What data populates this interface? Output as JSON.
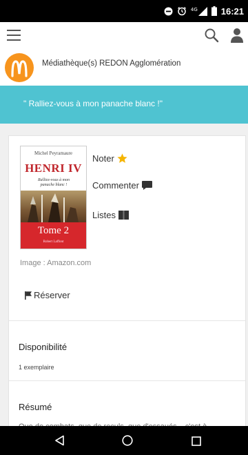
{
  "status_bar": {
    "time": "16:21",
    "network": "4G",
    "icons": [
      "do-not-disturb-icon",
      "alarm-icon",
      "signal-icon",
      "battery-icon"
    ]
  },
  "app_bar": {
    "icons": [
      "hamburger-menu-icon",
      "search-icon",
      "user-icon"
    ]
  },
  "library": {
    "name": "Médiathèque(s) REDON Agglomération",
    "logo_color": "#f7941d"
  },
  "banner": {
    "text": "\" Ralliez-vous à mon panache blanc !\"",
    "color": "#4fc3d1"
  },
  "book": {
    "cover": {
      "author": "Michel Peyramaure",
      "title": "HENRI IV",
      "subtitle": "Ralliez-vous à mon panache blanc !",
      "tome": "Tome 2",
      "publisher": "Robert Laffont"
    },
    "image_credit": "Image : Amazon.com",
    "actions": [
      {
        "label": "Noter",
        "icon": "star-icon"
      },
      {
        "label": "Commenter",
        "icon": "comment-icon"
      },
      {
        "label": "Listes",
        "icon": "book-icon"
      }
    ],
    "reserve_label": "Réserver"
  },
  "availability": {
    "title": "Disponibilité",
    "copies": "1 exemplaire"
  },
  "summary": {
    "title": "Résumé",
    "excerpt": "Que de combats, que de reculs, que d'essaués... c'est à"
  },
  "nav_bar": {
    "icons": [
      "back-icon",
      "home-icon",
      "recents-icon"
    ]
  }
}
